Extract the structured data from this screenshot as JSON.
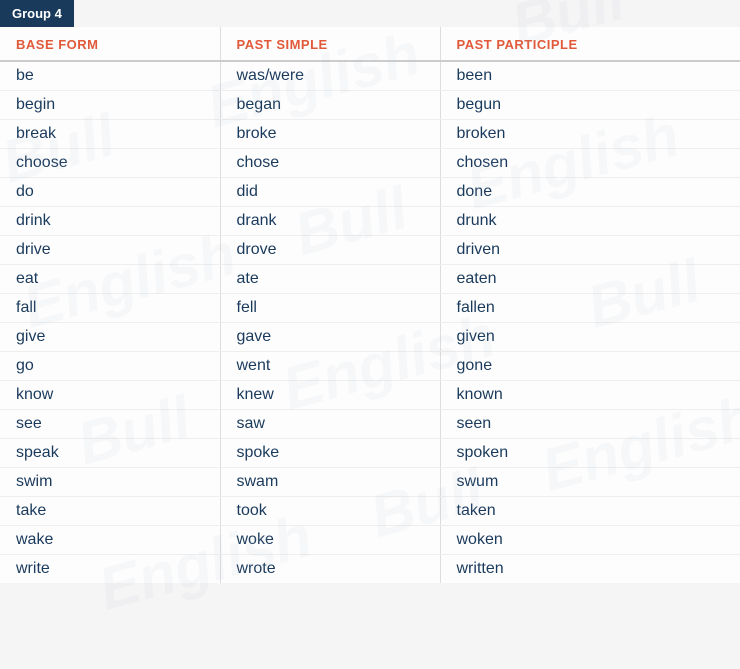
{
  "group": {
    "label": "Group 4"
  },
  "table": {
    "headers": {
      "base": "BASE FORM",
      "past_simple": "PAST SIMPLE",
      "past_participle": "PAST PARTICIPLE"
    },
    "rows": [
      {
        "base": "be",
        "past": "was/were",
        "participle": "been"
      },
      {
        "base": "begin",
        "past": "began",
        "participle": "begun"
      },
      {
        "base": "break",
        "past": "broke",
        "participle": "broken"
      },
      {
        "base": "choose",
        "past": "chose",
        "participle": "chosen"
      },
      {
        "base": "do",
        "past": "did",
        "participle": "done"
      },
      {
        "base": "drink",
        "past": "drank",
        "participle": "drunk"
      },
      {
        "base": "drive",
        "past": "drove",
        "participle": "driven"
      },
      {
        "base": "eat",
        "past": "ate",
        "participle": "eaten"
      },
      {
        "base": "fall",
        "past": "fell",
        "participle": "fallen"
      },
      {
        "base": "give",
        "past": "gave",
        "participle": "given"
      },
      {
        "base": "go",
        "past": "went",
        "participle": "gone"
      },
      {
        "base": "know",
        "past": "knew",
        "participle": "known"
      },
      {
        "base": "see",
        "past": "saw",
        "participle": "seen"
      },
      {
        "base": "speak",
        "past": "spoke",
        "participle": "spoken"
      },
      {
        "base": "swim",
        "past": "swam",
        "participle": "swum"
      },
      {
        "base": "take",
        "past": "took",
        "participle": "taken"
      },
      {
        "base": "wake",
        "past": "woke",
        "participle": "woken"
      },
      {
        "base": "write",
        "past": "wrote",
        "participle": "written"
      }
    ]
  },
  "watermark": {
    "texts": [
      "Bull",
      "English",
      "Bull",
      "English",
      "Bull",
      "English",
      "Bull",
      "English"
    ]
  }
}
